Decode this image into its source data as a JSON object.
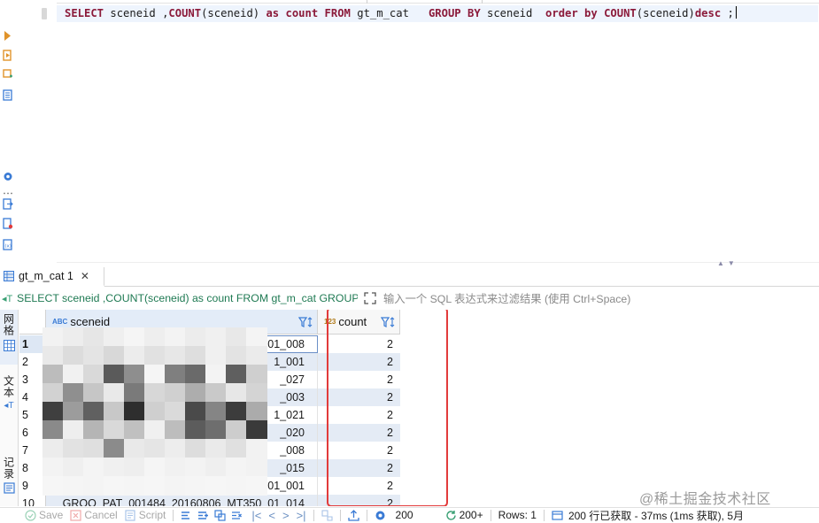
{
  "editor": {
    "sql_tokens": [
      {
        "t": "SELECT",
        "k": true
      },
      {
        "t": " sceneid ,",
        "k": false
      },
      {
        "t": "COUNT",
        "k": true
      },
      {
        "t": "(sceneid) ",
        "k": false
      },
      {
        "t": "as",
        "k": true
      },
      {
        "t": " ",
        "k": false
      },
      {
        "t": "count",
        "k": true
      },
      {
        "t": " ",
        "k": false
      },
      {
        "t": "FROM",
        "k": true
      },
      {
        "t": " gt_m_cat   ",
        "k": false
      },
      {
        "t": "GROUP BY",
        "k": true
      },
      {
        "t": " sceneid  ",
        "k": false
      },
      {
        "t": "order by",
        "k": true
      },
      {
        "t": " ",
        "k": false
      },
      {
        "t": "COUNT",
        "k": true
      },
      {
        "t": "(sceneid)",
        "k": false
      },
      {
        "t": "desc",
        "k": true
      },
      {
        "t": " ;",
        "k": false
      }
    ]
  },
  "results": {
    "tab_label": "gt_m_cat 1",
    "tab_close": "✕",
    "filter_query": "SELECT sceneid ,COUNT(sceneid) as count FROM gt_m_cat GROUP BY sceneid  order by COUNT(sceneid)desc",
    "filter_hint": "输入一个 SQL 表达式来过滤结果 (使用 Ctrl+Space)",
    "side_tabs": [
      "网格",
      "文本",
      "记录"
    ],
    "columns": [
      {
        "name": "sceneid",
        "type_badge": "ABC"
      },
      {
        "name": "count",
        "type_badge": "123"
      }
    ],
    "rows": [
      {
        "num": "1",
        "sceneid": "01_008",
        "count": "2"
      },
      {
        "num": "2",
        "sceneid": "1_001",
        "count": "2"
      },
      {
        "num": "3",
        "sceneid": "_027",
        "count": "2"
      },
      {
        "num": "4",
        "sceneid": "_003",
        "count": "2"
      },
      {
        "num": "5",
        "sceneid": "1_021",
        "count": "2"
      },
      {
        "num": "6",
        "sceneid": "_020",
        "count": "2"
      },
      {
        "num": "7",
        "sceneid": "_008",
        "count": "2"
      },
      {
        "num": "8",
        "sceneid": "_015",
        "count": "2"
      },
      {
        "num": "9",
        "sceneid": "01_001",
        "count": "2"
      },
      {
        "num": "10",
        "sceneid": "GROO_PAT_001484_20160806_MT350_01_014",
        "count": "2"
      }
    ]
  },
  "status_bar": {
    "save": "Save",
    "cancel": "Cancel",
    "script": "Script",
    "fetch_size": "200",
    "fetch_more": "200+",
    "rows": "Rows: 1",
    "summary": "200 行已获取 - 37ms (1ms 获取), 5月"
  },
  "watermark": "@稀土掘金技术社区",
  "colors": {
    "accent": "#3a7bd5",
    "keyword": "#8b1a3a",
    "highlight_box": "#e23b3b",
    "selected_row": "#e4ebf5"
  }
}
